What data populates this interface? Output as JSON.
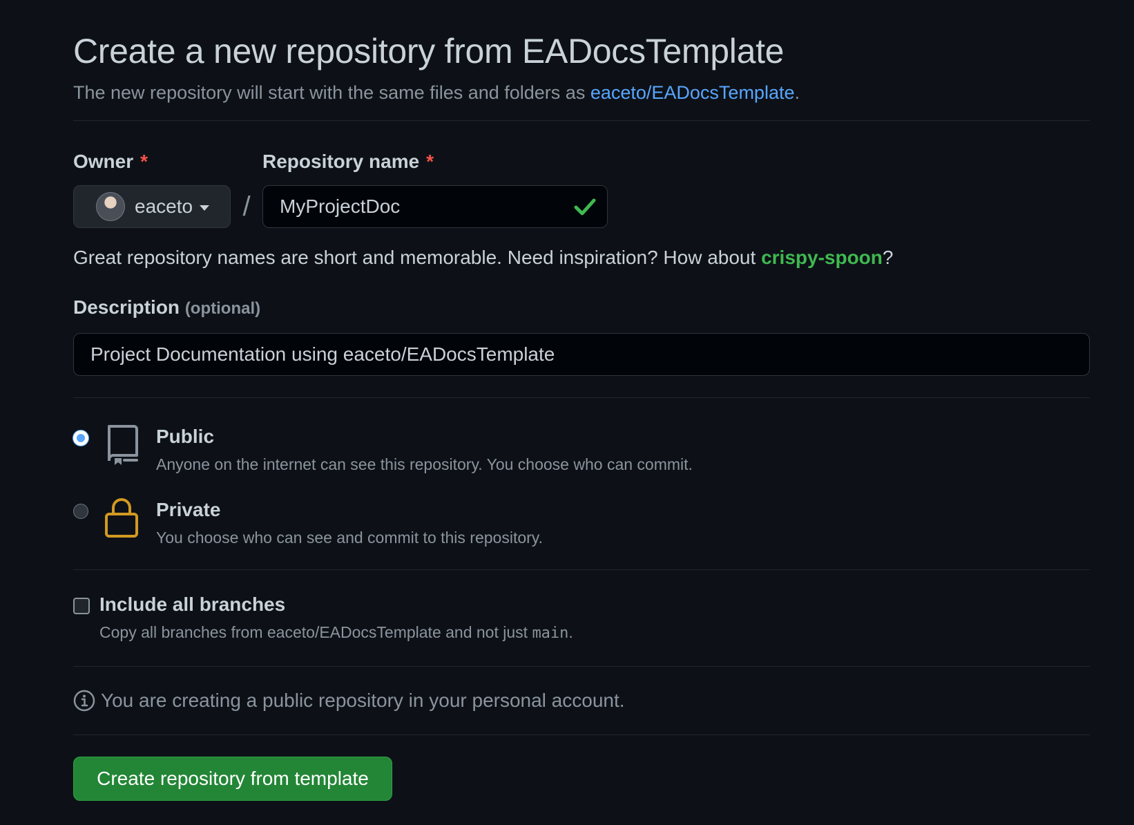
{
  "header": {
    "title": "Create a new repository from EADocsTemplate",
    "subtitle_prefix": "The new repository will start with the same files and folders as ",
    "subtitle_link": "eaceto/EADocsTemplate",
    "subtitle_suffix": "."
  },
  "owner": {
    "label": "Owner",
    "required_mark": "*",
    "value": "eaceto"
  },
  "separator": "/",
  "repo_name": {
    "label": "Repository name",
    "required_mark": "*",
    "value": "MyProjectDoc"
  },
  "hint": {
    "prefix": "Great repository names are short and memorable. Need inspiration? How about ",
    "suggestion": "crispy-spoon",
    "suffix": "?"
  },
  "description": {
    "label": "Description",
    "optional": "(optional)",
    "value": "Project Documentation using eaceto/EADocsTemplate"
  },
  "visibility": {
    "public": {
      "title": "Public",
      "desc": "Anyone on the internet can see this repository. You choose who can commit.",
      "icon": "repo-icon",
      "selected": true
    },
    "private": {
      "title": "Private",
      "desc": "You choose who can see and commit to this repository.",
      "icon": "lock-icon",
      "selected": false
    }
  },
  "branches": {
    "title": "Include all branches",
    "desc_prefix": "Copy all branches from eaceto/EADocsTemplate and not just ",
    "desc_code": "main",
    "desc_suffix": ".",
    "checked": false
  },
  "info": {
    "text": "You are creating a public repository in your personal account.",
    "icon": "info-icon"
  },
  "submit": {
    "label": "Create repository from template"
  },
  "colors": {
    "background": "#0d1117",
    "link": "#58a6ff",
    "success": "#3fb950",
    "danger": "#f85149",
    "button": "#238636",
    "lock": "#d29922"
  }
}
